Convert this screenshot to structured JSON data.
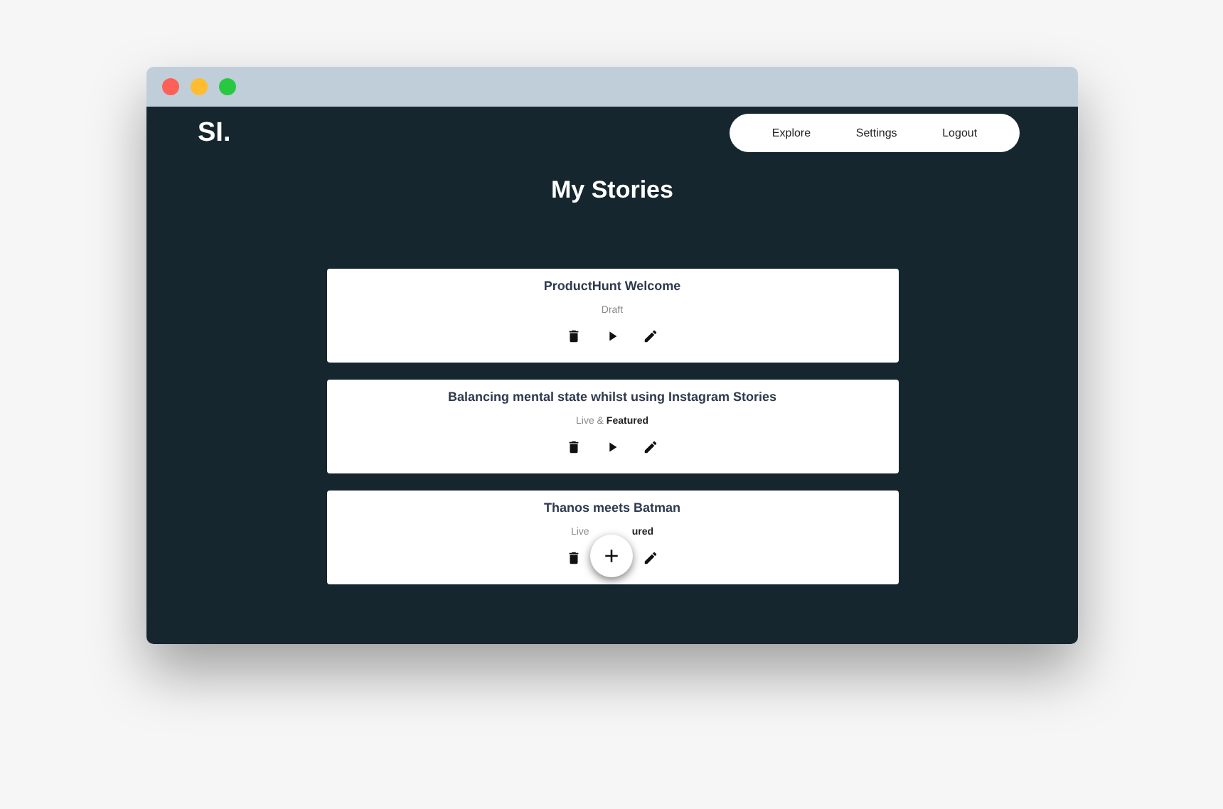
{
  "logo": "SI.",
  "nav": [
    "Explore",
    "Settings",
    "Logout"
  ],
  "title": "My Stories",
  "stories": [
    {
      "title": "ProductHunt Welcome",
      "status": [
        "Draft"
      ],
      "actions": [
        {
          "kind": "delete"
        },
        {
          "kind": "play"
        },
        {
          "kind": "edit"
        }
      ]
    },
    {
      "title": "Balancing mental state whilst using Instagram Stories",
      "status": [
        "Live & **Featured**"
      ],
      "actions": [
        {
          "kind": "delete"
        },
        {
          "kind": "play"
        },
        {
          "kind": "edit"
        }
      ]
    },
    {
      "title": "Thanos meets Batman",
      "status": [
        "Live",
        "**ured**"
      ],
      "actions": [
        {
          "kind": "delete"
        },
        {
          "kind": "hidden"
        },
        {
          "kind": "edit"
        }
      ]
    }
  ],
  "fab": "+"
}
